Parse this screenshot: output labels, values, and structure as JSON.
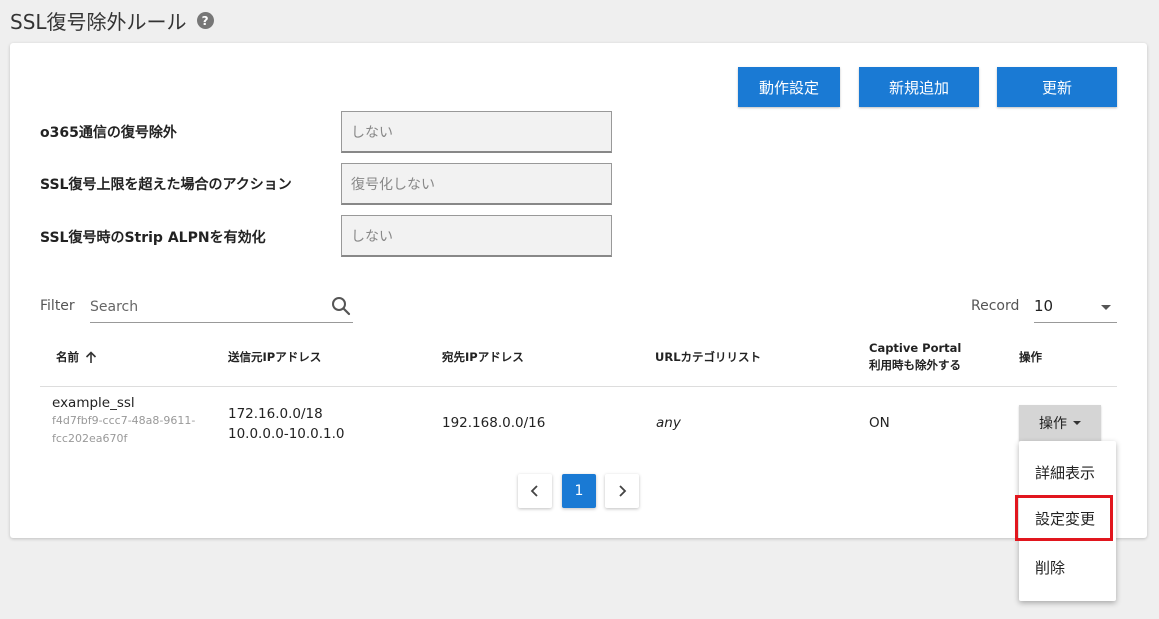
{
  "page": {
    "title": "SSL復号除外ルール"
  },
  "toolbar": {
    "action_settings_label": "動作設定",
    "new_add_label": "新規追加",
    "refresh_label": "更新"
  },
  "settings": [
    {
      "label": "o365通信の復号除外",
      "value": "しない"
    },
    {
      "label": "SSL復号上限を超えた場合のアクション",
      "value": "復号化しない"
    },
    {
      "label": "SSL復号時のStrip ALPNを有効化",
      "value": "しない"
    }
  ],
  "filter": {
    "label": "Filter",
    "placeholder": "Search"
  },
  "record": {
    "label": "Record",
    "value": "10"
  },
  "table": {
    "headers": {
      "name": "名前",
      "source_ip": "送信元IPアドレス",
      "dest_ip": "宛先IPアドレス",
      "url_category": "URLカテゴリリスト",
      "captive_line1": "Captive Portal",
      "captive_line2": "利用時も除外する",
      "actions": "操作"
    },
    "rows": [
      {
        "name": "example_ssl",
        "uuid_line1": "f4d7fbf9-ccc7-48a8-9611-",
        "uuid_line2": "fcc202ea670f",
        "source_ip_1": "172.16.0.0/18",
        "source_ip_2": "10.0.0.0-10.0.1.0",
        "dest_ip": "192.168.0.0/16",
        "url_category": "any",
        "captive": "ON",
        "actions_label": "操作"
      }
    ]
  },
  "pagination": {
    "current_page": "1",
    "prev_icon": "chevron-left-icon",
    "next_icon": "chevron-right-icon"
  },
  "action_menu": {
    "items": [
      {
        "label": "詳細表示"
      },
      {
        "label": "設定変更"
      },
      {
        "label": "削除"
      }
    ]
  },
  "colors": {
    "primary": "#1a7ad4",
    "highlight": "#e1161e"
  }
}
